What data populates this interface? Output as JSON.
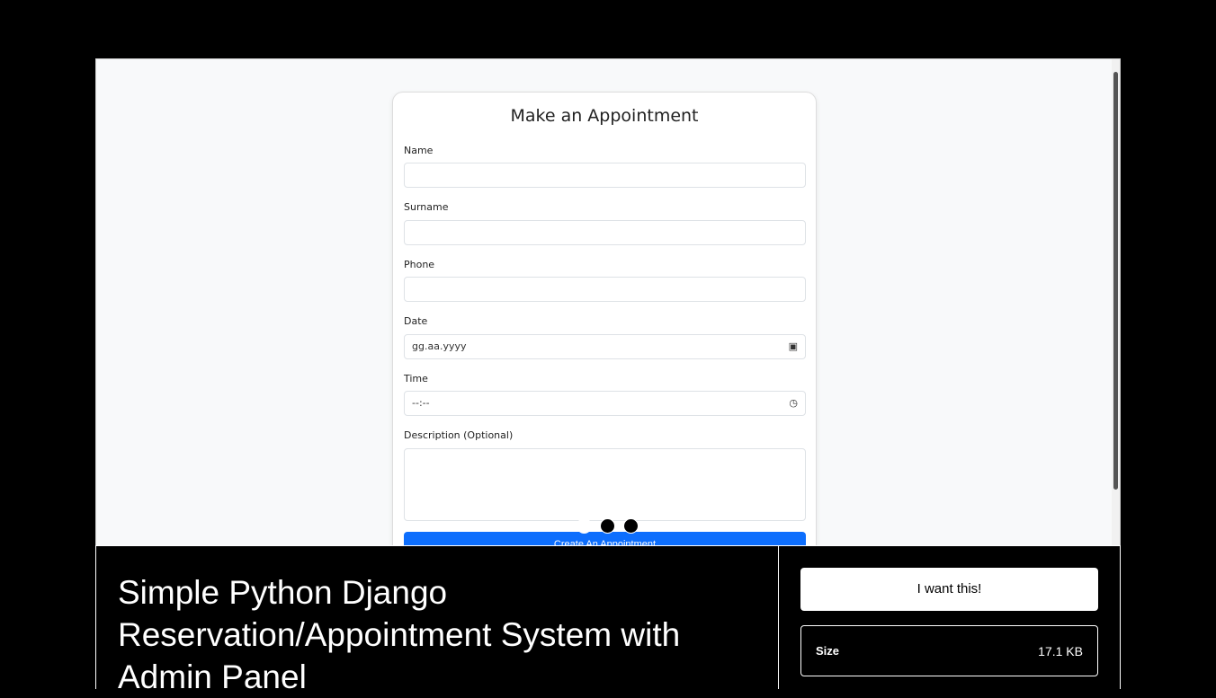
{
  "form": {
    "title": "Make an Appointment",
    "fields": [
      {
        "label": "Name",
        "value": ""
      },
      {
        "label": "Surname",
        "value": ""
      },
      {
        "label": "Phone",
        "value": ""
      },
      {
        "label": "Date",
        "value": "gg.aa.yyyy"
      },
      {
        "label": "Time",
        "value": "--:--"
      },
      {
        "label": "Description (Optional)",
        "value": ""
      }
    ],
    "submit": "Create An Appointment"
  },
  "product": {
    "title": "Simple Python Django Reservation/Appointment System with Admin Panel",
    "buy": "I want this!",
    "size_label": "Size",
    "size_value": "17.1 KB"
  }
}
